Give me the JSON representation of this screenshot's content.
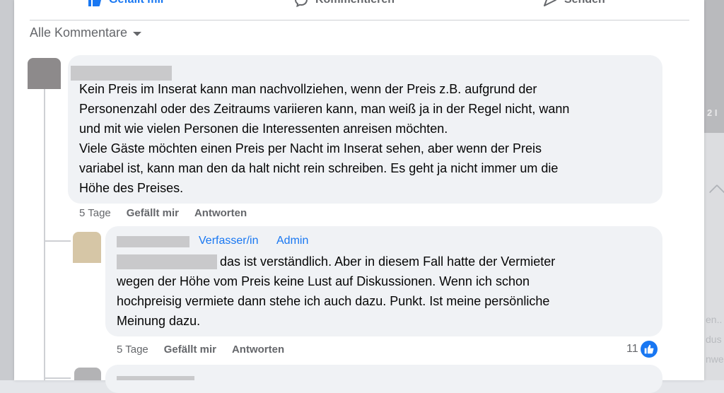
{
  "actions": {
    "like_label": "Gefällt mir",
    "comment_label": "Kommentieren",
    "send_label": "Senden"
  },
  "filter": {
    "label": "Alle Kommentare"
  },
  "comment1": {
    "text": "Kein Preis im Inserat kann man nachvollziehen, wenn der Preis z.B. aufgrund der\nPersonenzahl oder des Zeitraums variieren kann, man weiß ja in der Regel nicht, wann\nund mit wie vielen Personen die Interessenten anreisen möchten.\nViele Gäste möchten einen Preis per Nacht im Inserat sehen, aber wenn der Preis\nvariabel ist, kann man den da halt nicht rein schreiben. Es geht ja nicht immer um die\nHöhe des Preises.",
    "time": "5 Tage",
    "like_label": "Gefällt mir",
    "reply_label": "Antworten"
  },
  "comment2": {
    "badge_author": "Verfasser/in",
    "badge_admin": "Admin",
    "text_first": "das ist verständlich. Aber in diesem Fall hatte der Vermieter",
    "text_rest": "wegen der Höhe vom Preis keine Lust auf Diskussionen. Wenn ich schon\nhochpreisig vermiete dann stehe ich auch dazu. Punkt. Ist meine persönliche\nMeinung dazu.",
    "time": "5 Tage",
    "like_label": "Gefällt mir",
    "reply_label": "Antworten",
    "reaction_count": "11"
  },
  "right_bg": {
    "top_text": "2 I",
    "line1": "en..",
    "line2": "dus",
    "line3": "nwe"
  },
  "colors": {
    "accent": "#1877f2",
    "bubble": "#f0f2f5",
    "secondary_text": "#65676b"
  }
}
